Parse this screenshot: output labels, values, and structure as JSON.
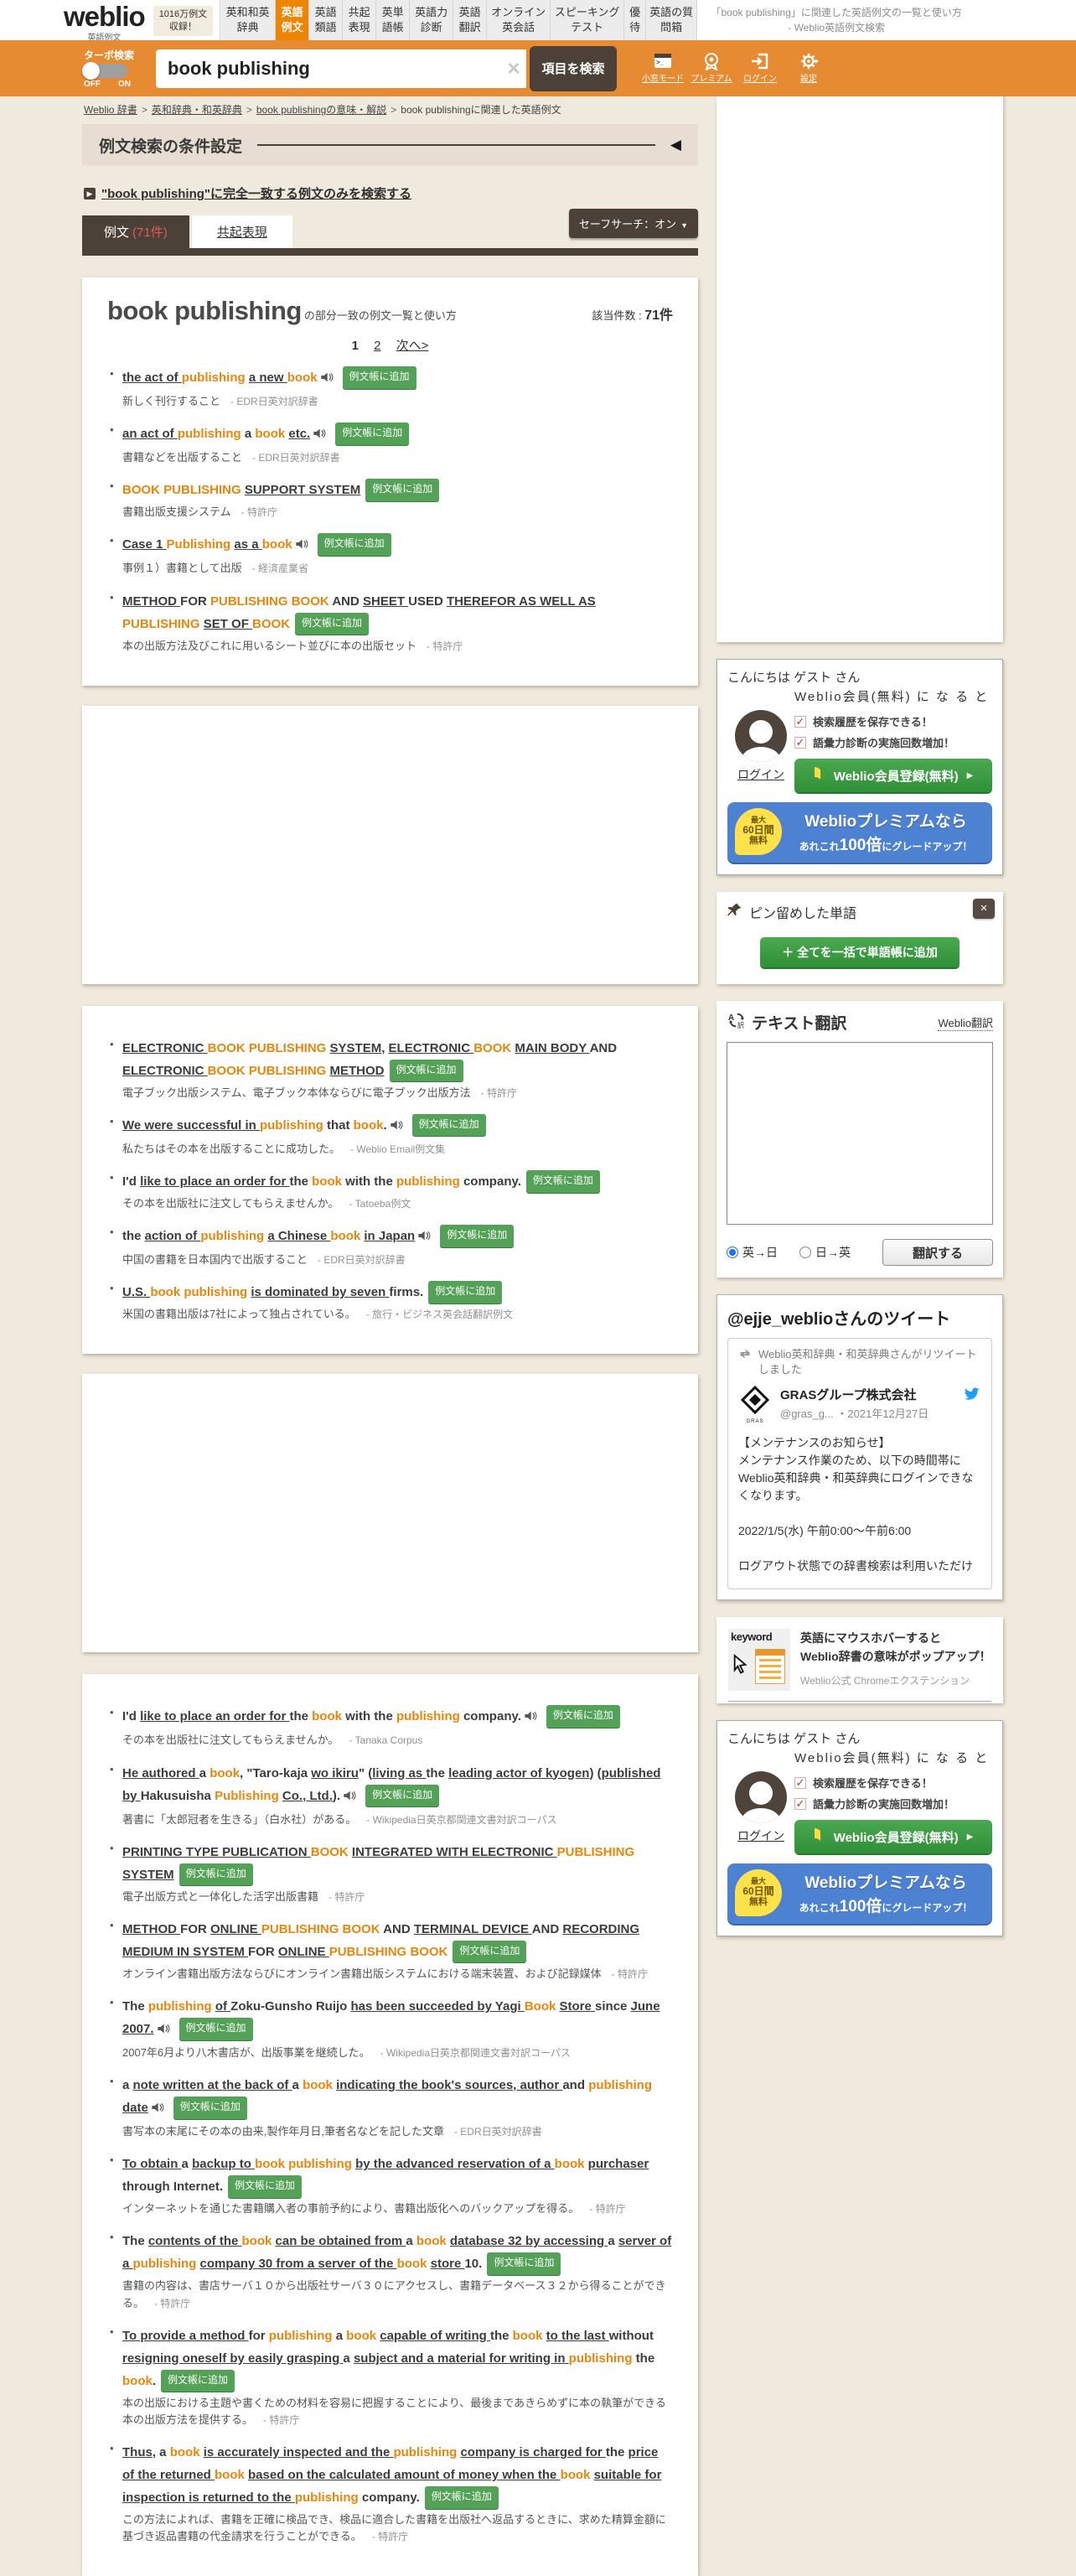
{
  "header": {
    "logo": "weblio",
    "logo_sub": "英語例文",
    "badge": "1016万例文\n収録！",
    "tabs": [
      {
        "label": "英和和英辞典",
        "active": false
      },
      {
        "label": "英語例文",
        "active": true
      },
      {
        "label": "英語類語",
        "active": false
      },
      {
        "label": "共起表現",
        "active": false
      },
      {
        "label": "英単語帳",
        "active": false
      },
      {
        "label": "英語力診断",
        "active": false
      },
      {
        "label": "英語翻訳",
        "active": false
      },
      {
        "label": "オンライン英会話",
        "active": false
      },
      {
        "label": "スピーキングテスト",
        "active": false
      },
      {
        "label": "優待",
        "active": false
      },
      {
        "label": "英語の質問箱",
        "active": false
      }
    ],
    "page_title": "「book publishing」に関連した英語例文の一覧と使い方 - Weblio英語例文検索"
  },
  "searchbar": {
    "turbo_label": "ターボ検索",
    "off": "OFF",
    "on": "ON",
    "query": "book publishing",
    "clear": "×",
    "search_button": "項目を検索",
    "icons": [
      {
        "name": "小窓モード"
      },
      {
        "name": "プレミアム"
      },
      {
        "name": "ログイン"
      },
      {
        "name": "設定"
      }
    ]
  },
  "breadcrumb": {
    "items": [
      "Weblio 辞書",
      "英和辞典・和英辞典",
      "book publishingの意味・解説",
      "book publishingに関連した英語例文"
    ]
  },
  "condition": {
    "title": "例文検索の条件設定",
    "arrow": "◀"
  },
  "exact_link": "\"book publishing\"に完全一致する例文のみを検索する",
  "result_tabs": {
    "reibun": "例文",
    "count": "(71件)",
    "kyoki": "共起表現",
    "safesearch": "セーフサーチ：オン",
    "safesearch_caret": "▼"
  },
  "results": {
    "term": "book publishing",
    "subtitle": "の部分一致の例文一覧と使い方",
    "hits_label": "該当件数 : ",
    "hits": "71件",
    "pagination": {
      "current": "1",
      "page2": "2",
      "next": "次へ>"
    }
  },
  "badge_label": "例文帳に追加",
  "cards": [
    {
      "items": [
        {
          "en": [
            [
              "u",
              "the act of "
            ],
            [
              "h",
              "publishing "
            ],
            [
              "u",
              "a new "
            ],
            [
              "h",
              "book"
            ]
          ],
          "audio": true,
          "jp": "新しく刊行すること",
          "src": "EDR日英対訳辞書"
        },
        {
          "en": [
            [
              "u",
              "an act of "
            ],
            [
              "h",
              "publishing "
            ],
            [
              "p",
              "a "
            ],
            [
              "h",
              "book "
            ],
            [
              "u",
              "etc."
            ]
          ],
          "audio": true,
          "jp": "書籍などを出版すること",
          "src": "EDR日英対訳辞書"
        },
        {
          "en": [
            [
              "h",
              "BOOK PUBLISHING "
            ],
            [
              "u",
              "SUPPORT SYSTEM"
            ]
          ],
          "audio": false,
          "jp": "書籍出版支援システム",
          "src": "特許庁"
        },
        {
          "en": [
            [
              "u",
              "Case 1 "
            ],
            [
              "h",
              "Publishing "
            ],
            [
              "u",
              "as a "
            ],
            [
              "h",
              "book"
            ]
          ],
          "audio": true,
          "jp": "事例１）書籍として出版",
          "src": "経済産業省"
        },
        {
          "en": [
            [
              "u",
              "METHOD "
            ],
            [
              "p",
              "FOR "
            ],
            [
              "h",
              "PUBLISHING BOOK "
            ],
            [
              "p",
              "AND "
            ],
            [
              "u",
              "SHEET "
            ],
            [
              "p",
              "USED "
            ],
            [
              "u",
              "THEREFOR AS WELL AS "
            ],
            [
              "h",
              "PUBLISHING "
            ],
            [
              "u",
              "SET OF "
            ],
            [
              "h",
              "BOOK"
            ]
          ],
          "audio": false,
          "jp": "本の出版方法及びこれに用いるシート並びに本の出版セット",
          "src": "特許庁"
        }
      ]
    },
    {
      "items": [
        {
          "en": [
            [
              "u",
              "ELECTRONIC "
            ],
            [
              "h",
              "BOOK PUBLISHING "
            ],
            [
              "u",
              "SYSTEM"
            ],
            [
              "p",
              ", "
            ],
            [
              "u",
              "ELECTRONIC "
            ],
            [
              "h",
              "BOOK "
            ],
            [
              "u",
              "MAIN BODY "
            ],
            [
              "p",
              "AND "
            ],
            [
              "u",
              "ELECTRONIC "
            ],
            [
              "h",
              "BOOK PUBLISHING "
            ],
            [
              "u",
              "METHOD"
            ]
          ],
          "audio": false,
          "jp": "電子ブック出版システム、電子ブック本体ならびに電子ブック出版方法",
          "src": "特許庁"
        },
        {
          "en": [
            [
              "u",
              "We were successful in "
            ],
            [
              "h",
              "publishing "
            ],
            [
              "p",
              "that "
            ],
            [
              "h",
              "book"
            ],
            [
              "p",
              "."
            ]
          ],
          "audio": true,
          "jp": "私たちはその本を出版することに成功した。",
          "src": "Weblio Email例文集"
        },
        {
          "en": [
            [
              "p",
              "I'd "
            ],
            [
              "u",
              "like to place an order for "
            ],
            [
              "p",
              "the "
            ],
            [
              "h",
              "book "
            ],
            [
              "p",
              "with the "
            ],
            [
              "h",
              "publishing "
            ],
            [
              "p",
              "company."
            ]
          ],
          "audio": false,
          "jp": "その本を出版社に注文してもらえませんか。",
          "src": "Tatoeba例文"
        },
        {
          "en": [
            [
              "p",
              "the "
            ],
            [
              "u",
              "action of "
            ],
            [
              "h",
              "publishing "
            ],
            [
              "u",
              "a Chinese "
            ],
            [
              "h",
              "book "
            ],
            [
              "u",
              "in Japan"
            ]
          ],
          "audio": true,
          "jp": "中国の書籍を日本国内で出版すること",
          "src": "EDR日英対訳辞書"
        },
        {
          "en": [
            [
              "u",
              "U.S. "
            ],
            [
              "h",
              "book publishing "
            ],
            [
              "u",
              "is dominated by seven "
            ],
            [
              "p",
              "firms."
            ]
          ],
          "audio": false,
          "jp": "米国の書籍出版は7社によって独占されている。",
          "src": "旅行・ビジネス英会話翻訳例文"
        }
      ]
    },
    {
      "items": [
        {
          "en": [
            [
              "p",
              "I'd "
            ],
            [
              "u",
              "like to place an order for "
            ],
            [
              "p",
              "the "
            ],
            [
              "h",
              "book "
            ],
            [
              "p",
              "with the "
            ],
            [
              "h",
              "publishing "
            ],
            [
              "p",
              "company."
            ]
          ],
          "audio": true,
          "jp": "その本を出版社に注文してもらえませんか。",
          "src": "Tanaka Corpus"
        },
        {
          "en": [
            [
              "u",
              "He authored "
            ],
            [
              "p",
              "a "
            ],
            [
              "h",
              "book"
            ],
            [
              "p",
              ", \"Taro-kaja "
            ],
            [
              "u",
              "wo ikiru"
            ],
            [
              "p",
              "\" ("
            ],
            [
              "u",
              "living as "
            ],
            [
              "p",
              "the "
            ],
            [
              "u",
              "leading actor of kyogen"
            ],
            [
              "p",
              ") ("
            ],
            [
              "u",
              "published by "
            ],
            [
              "p",
              "Hakusuisha "
            ],
            [
              "h",
              "Publishing "
            ],
            [
              "u",
              "Co., Ltd."
            ],
            [
              "p",
              ")."
            ]
          ],
          "audio": true,
          "jp": "著書に「太郎冠者を生きる」（白水社）がある。",
          "src": "Wikipedia日英京都関連文書対訳コーパス"
        },
        {
          "en": [
            [
              "u",
              "PRINTING TYPE PUBLICATION "
            ],
            [
              "h",
              "BOOK "
            ],
            [
              "u",
              "INTEGRATED WITH ELECTRONIC "
            ],
            [
              "h",
              "PUBLISHING "
            ],
            [
              "u",
              "SYSTEM"
            ]
          ],
          "audio": false,
          "jp": "電子出版方式と一体化した活字出版書籍",
          "src": "特許庁"
        },
        {
          "en": [
            [
              "u",
              "METHOD "
            ],
            [
              "p",
              "FOR "
            ],
            [
              "u",
              "ONLINE "
            ],
            [
              "h",
              "PUBLISHING BOOK "
            ],
            [
              "p",
              "AND "
            ],
            [
              "u",
              "TERMINAL DEVICE "
            ],
            [
              "p",
              "AND "
            ],
            [
              "u",
              "RECORDING MEDIUM IN SYSTEM "
            ],
            [
              "p",
              "FOR "
            ],
            [
              "u",
              "ONLINE "
            ],
            [
              "h",
              "PUBLISHING BOOK"
            ]
          ],
          "audio": false,
          "jp": "オンライン書籍出版方法ならびにオンライン書籍出版システムにおける端末装置、および記録媒体",
          "src": "特許庁"
        },
        {
          "en": [
            [
              "p",
              "The "
            ],
            [
              "h",
              "publishing "
            ],
            [
              "u",
              "of "
            ],
            [
              "p",
              "Zoku-Gunsho Ruijo "
            ],
            [
              "u",
              "has been succeeded by Yagi "
            ],
            [
              "h",
              "Book "
            ],
            [
              "u",
              "Store "
            ],
            [
              "p",
              "since "
            ],
            [
              "u",
              "June 2007."
            ]
          ],
          "audio": true,
          "jp": "2007年6月より八木書店が、出版事業を継続した。",
          "src": "Wikipedia日英京都関連文書対訳コーパス"
        },
        {
          "en": [
            [
              "p",
              "a "
            ],
            [
              "u",
              "note written at the back of "
            ],
            [
              "p",
              "a "
            ],
            [
              "h",
              "book "
            ],
            [
              "u",
              "indicating the book's sources, author "
            ],
            [
              "p",
              "and "
            ],
            [
              "h",
              "publishing "
            ],
            [
              "u",
              "date"
            ]
          ],
          "audio": true,
          "jp": "書写本の末尾にその本の由来,製作年月日,筆者名などを記した文章",
          "src": "EDR日英対訳辞書"
        },
        {
          "en": [
            [
              "u",
              "To obtain "
            ],
            [
              "p",
              "a "
            ],
            [
              "u",
              "backup to "
            ],
            [
              "h",
              "book publishing "
            ],
            [
              "u",
              "by the advanced reservation of a "
            ],
            [
              "h",
              "book "
            ],
            [
              "u",
              "purchaser "
            ],
            [
              "p",
              "through Internet."
            ]
          ],
          "audio": false,
          "jp": "インターネットを通じた書籍購入者の事前予約により、書籍出版化へのバックアップを得る。",
          "src": "特許庁"
        },
        {
          "en": [
            [
              "p",
              "The "
            ],
            [
              "u",
              "contents of the "
            ],
            [
              "h",
              "book "
            ],
            [
              "u",
              "can be obtained from "
            ],
            [
              "p",
              "a "
            ],
            [
              "h",
              "book "
            ],
            [
              "u",
              "database 32 by accessing "
            ],
            [
              "p",
              "a "
            ],
            [
              "u",
              "server of a "
            ],
            [
              "h",
              "publishing "
            ],
            [
              "u",
              "company 30 from a server of the "
            ],
            [
              "h",
              "book "
            ],
            [
              "u",
              "store "
            ],
            [
              "p",
              "10."
            ]
          ],
          "audio": false,
          "jp": "書籍の内容は、書店サーバ１０から出版社サーバ３０にアクセスし、書籍データベース３２から得ることができる。",
          "src": "特許庁"
        },
        {
          "en": [
            [
              "u",
              "To provide a method "
            ],
            [
              "p",
              "for "
            ],
            [
              "h",
              "publishing "
            ],
            [
              "p",
              "a "
            ],
            [
              "h",
              "book "
            ],
            [
              "u",
              "capable of writing "
            ],
            [
              "p",
              "the "
            ],
            [
              "h",
              "book "
            ],
            [
              "u",
              "to the last "
            ],
            [
              "p",
              "without "
            ],
            [
              "u",
              "resigning oneself by easily grasping "
            ],
            [
              "p",
              "a "
            ],
            [
              "u",
              "subject and a material for writing in "
            ],
            [
              "h",
              "publishing "
            ],
            [
              "p",
              "the "
            ],
            [
              "h",
              "book"
            ],
            [
              "p",
              "."
            ]
          ],
          "audio": false,
          "jp": "本の出版における主題や書くための材料を容易に把握することにより、最後まであきらめずに本の執筆ができる本の出版方法を提供する。",
          "src": "特許庁"
        },
        {
          "en": [
            [
              "u",
              "Thus"
            ],
            [
              "p",
              ", a "
            ],
            [
              "h",
              "book "
            ],
            [
              "u",
              "is accurately inspected and the "
            ],
            [
              "h",
              "publishing "
            ],
            [
              "u",
              "company is charged for "
            ],
            [
              "p",
              "the "
            ],
            [
              "u",
              "price of the returned "
            ],
            [
              "h",
              "book "
            ],
            [
              "u",
              "based on the calculated amount of money when the "
            ],
            [
              "h",
              "book "
            ],
            [
              "u",
              "suitable for inspection is returned to the "
            ],
            [
              "h",
              "publishing "
            ],
            [
              "p",
              "company."
            ]
          ],
          "audio": false,
          "jp": "この方法によれば、書籍を正確に検品でき、検品に適合した書籍を出版社へ返品するときに、求めた精算金額に基づき返品書籍の代金請求を行うことができる。",
          "src": "特許庁"
        }
      ]
    }
  ],
  "sidebar": {
    "guest": {
      "greeting": "こんにちは ゲスト さん",
      "member_lead": "Weblio会員(無料) に な る と",
      "benefits": [
        "検索履歴を保存できる！",
        "語彙力診断の実施回数増加！"
      ],
      "login": "ログイン",
      "register": "Weblio会員登録(無料)",
      "register_arrow": "▶",
      "premium_badge": [
        "最大",
        "60日間",
        "無料"
      ],
      "premium_line1": "Weblioプレミアムなら",
      "premium_pre": "あれこれ",
      "premium_100": "100倍",
      "premium_post": "にグレードアップ！"
    },
    "pinned": {
      "title": "ピン留めした単語",
      "close": "×",
      "add_all": "＋ 全てを一括で単語帳に追加"
    },
    "translate": {
      "title": "テキスト翻訳",
      "link": "Weblio翻訳",
      "radio_en_ja": "英→日",
      "radio_ja_en": "日→英",
      "button": "翻訳する"
    },
    "tweet": {
      "title": "@ejje_weblioさんのツイート",
      "retweet": "Weblio英和辞典・和英辞典さんがリツイートしました",
      "name": "GRASグループ株式会社",
      "logo_caption": "GRAS",
      "handle": "@gras_g... ・2021年12月27日",
      "body": "【メンテナンスのお知らせ】\nメンテナンス作業のため、以下の時間帯にWeblio英和辞典・和英辞典にログインできなくなります。\n\n2022/1/5(水) 午前0:00～午前6:00\n\nログアウト状態での辞書検索は利用いただけ"
    },
    "keyword": {
      "img_label": "keyword",
      "line1": "英語にマウスホバーすると",
      "line2": "Weblio辞書の意味がポップアップ！",
      "sub": "Weblio公式 Chromeエクステンション"
    }
  },
  "colors": {
    "accent_orange": "#e78b33",
    "tab_orange": "#ee8502",
    "dark_brown": "#4b4138",
    "badge_green": "#54a257",
    "premium_blue": "#4d82d3",
    "highlight": "#e8860d"
  }
}
